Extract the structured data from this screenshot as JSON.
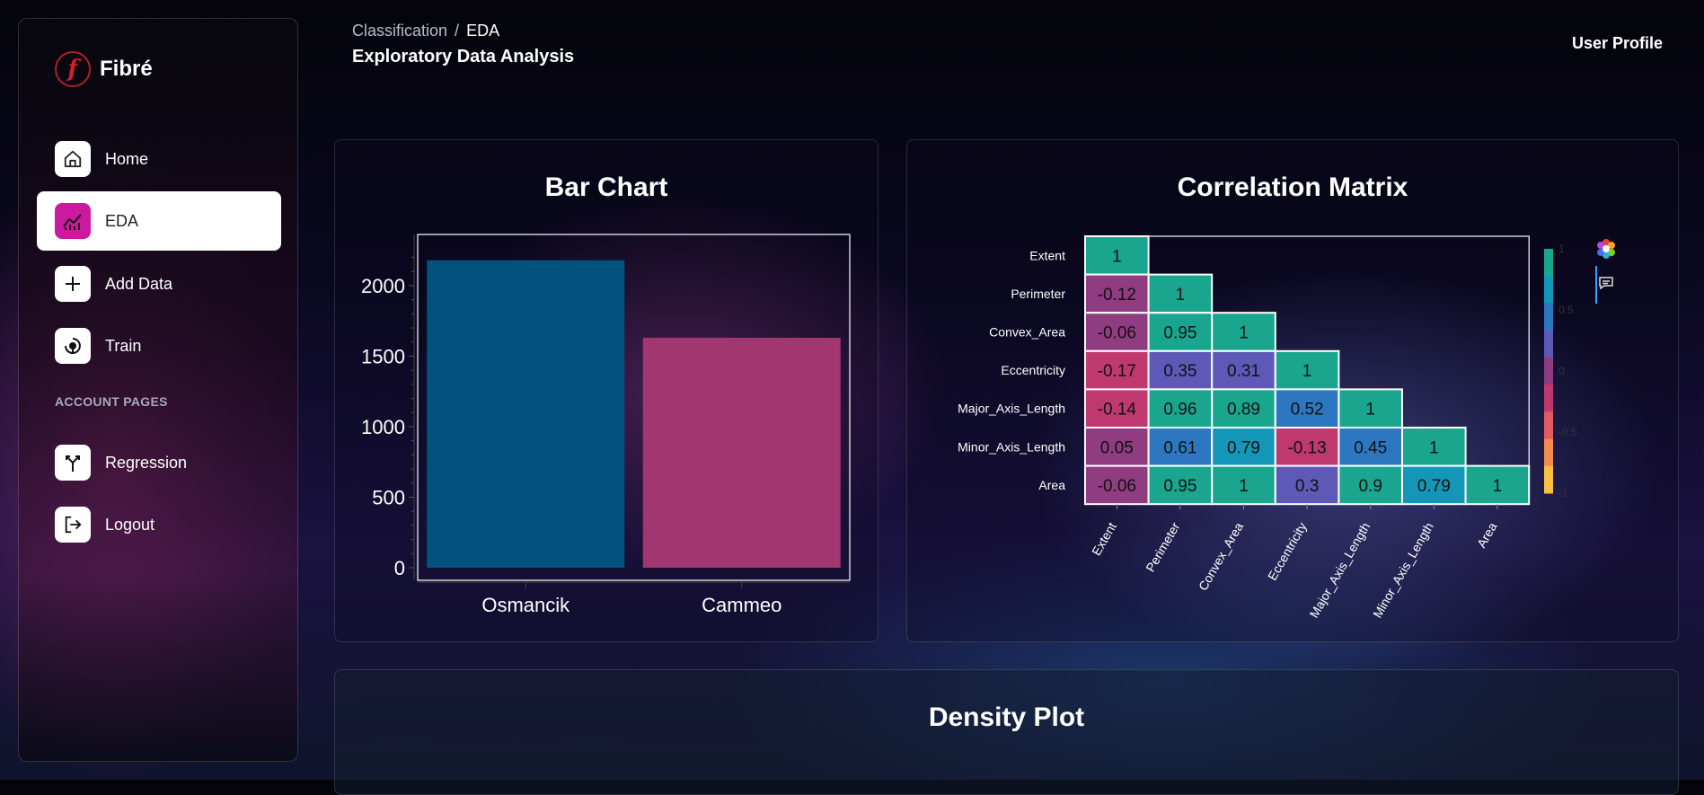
{
  "brand": {
    "name": "Fibré",
    "logo_letter": "f"
  },
  "sidebar": {
    "items": [
      {
        "label": "Home",
        "icon": "home-icon",
        "active": false
      },
      {
        "label": "EDA",
        "icon": "chart-icon",
        "active": true
      },
      {
        "label": "Add Data",
        "icon": "plus-icon",
        "active": false
      },
      {
        "label": "Train",
        "icon": "train-icon",
        "active": false
      }
    ],
    "section_title": "ACCOUNT PAGES",
    "account_items": [
      {
        "label": "Regression",
        "icon": "regression-icon"
      },
      {
        "label": "Logout",
        "icon": "logout-icon"
      }
    ]
  },
  "header": {
    "breadcrumb_parent": "Classification",
    "breadcrumb_separator": "/",
    "breadcrumb_current": "EDA",
    "page_title": "Exploratory Data Analysis",
    "user_profile": "User Profile"
  },
  "colors": {
    "accent": "#cc1aa0",
    "bar_osmancik": "#03527e",
    "bar_cammeo": "#a23671"
  },
  "cards": {
    "bar_title": "Bar Chart",
    "corr_title": "Correlation Matrix",
    "density_title": "Density Plot"
  },
  "chart_data": [
    {
      "type": "bar",
      "title": "Bar Chart",
      "categories": [
        "Osmancik",
        "Cammeo"
      ],
      "values": [
        2180,
        1630
      ],
      "ylim": [
        0,
        2350
      ],
      "yticks": [
        0,
        500,
        1000,
        1500,
        2000
      ],
      "colors": [
        "#03527e",
        "#a23671"
      ]
    },
    {
      "type": "heatmap",
      "title": "Correlation Matrix",
      "rows": [
        "Extent",
        "Perimeter",
        "Convex_Area",
        "Eccentricity",
        "Major_Axis_Length",
        "Minor_Axis_Length",
        "Area"
      ],
      "cols": [
        "Extent",
        "Perimeter",
        "Convex_Area",
        "Eccentricity",
        "Major_Axis_Length",
        "Minor_Axis_Length",
        "Area"
      ],
      "values": [
        [
          1
        ],
        [
          -0.12,
          1
        ],
        [
          -0.06,
          0.95,
          1
        ],
        [
          -0.17,
          0.35,
          0.31,
          1
        ],
        [
          -0.14,
          0.96,
          0.89,
          0.52,
          1
        ],
        [
          0.05,
          0.61,
          0.79,
          -0.13,
          0.45,
          1
        ],
        [
          -0.06,
          0.95,
          1,
          0.3,
          0.9,
          0.79,
          1
        ]
      ],
      "colorbar_ticks": [
        "1",
        "0.5",
        "0",
        "-0.5",
        "-1"
      ],
      "colorscale": [
        "#fcc040",
        "#f58b50",
        "#e25a62",
        "#c0396e",
        "#8f3c80",
        "#5e58b6",
        "#2d77c0",
        "#1496b8",
        "#1aa58f"
      ]
    }
  ]
}
